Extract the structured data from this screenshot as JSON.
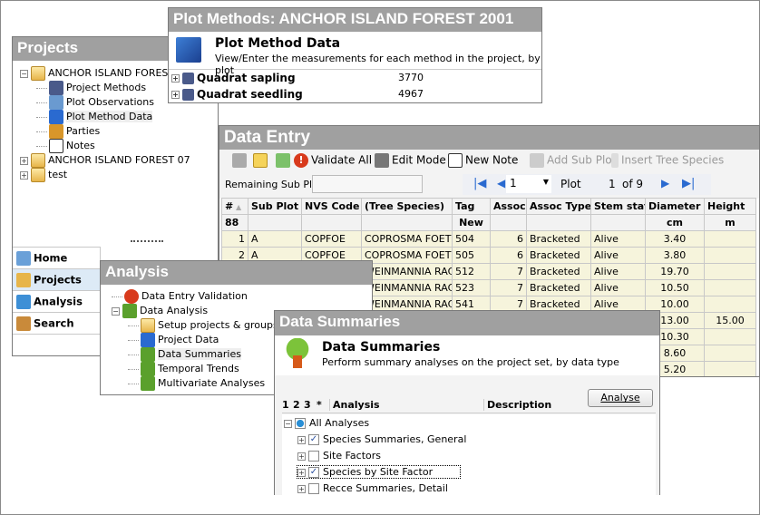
{
  "projects": {
    "title": "Projects",
    "tree": [
      {
        "label": "ANCHOR ISLAND FOREST",
        "exp": "−",
        "icon": "project-folder-icon",
        "level": 0
      },
      {
        "label": "Project Methods",
        "icon": "methods-icon",
        "level": 1
      },
      {
        "label": "Plot Observations",
        "icon": "plot-observations-icon",
        "level": 1
      },
      {
        "label": "Plot Method Data",
        "icon": "plot-method-data-icon",
        "level": 1,
        "selected": true
      },
      {
        "label": "Parties",
        "icon": "parties-icon",
        "level": 1
      },
      {
        "label": "Notes",
        "icon": "notes-icon",
        "level": 1
      },
      {
        "label": "ANCHOR ISLAND FOREST 07",
        "exp": "+",
        "icon": "project-folder-icon",
        "level": 0
      },
      {
        "label": "test",
        "exp": "+",
        "icon": "project-folder-icon",
        "level": 0
      }
    ],
    "nav": [
      {
        "label": "Home",
        "icon": "home-icon"
      },
      {
        "label": "Projects",
        "icon": "projects-icon",
        "selected": true
      },
      {
        "label": "Analysis",
        "icon": "analysis-icon"
      },
      {
        "label": "Search",
        "icon": "search-icon"
      }
    ]
  },
  "plot_methods": {
    "title": "Plot Methods: ANCHOR ISLAND FOREST 2001",
    "heading": "Plot Method Data",
    "subheading": "View/Enter the measurements for each method in the project, by plot",
    "rows": [
      {
        "name": "Quadrat sapling",
        "count": "3770"
      },
      {
        "name": "Quadrat seedling",
        "count": "4967"
      }
    ]
  },
  "data_entry": {
    "title": "Data Entry",
    "toolbar": {
      "validate_all": "Validate All",
      "edit_mode": "Edit Mode",
      "new_note": "New Note",
      "add_sub_plot": "Add Sub Plot",
      "insert_tree_species": "Insert Tree Species"
    },
    "remaining_label": "Remaining Sub Plots",
    "remaining_value": "",
    "pager": {
      "current": "1",
      "label": "Plot",
      "position": "1",
      "of": "of 9"
    },
    "columns": [
      "#",
      "Sub Plot",
      "NVS Code",
      "(Tree Species)",
      "Tag",
      "Assoc",
      "Assoc Type",
      "Stem stat",
      "Diameter",
      "Height"
    ],
    "units": [
      "88",
      "",
      "",
      "",
      "New",
      "",
      "",
      "",
      "cm",
      "m"
    ],
    "rows": [
      [
        "1",
        "A",
        "COPFOE",
        "COPROSMA FOETID",
        "504",
        "6",
        "Bracketed",
        "Alive",
        "3.40",
        ""
      ],
      [
        "2",
        "A",
        "COPFOE",
        "COPROSMA FOETID",
        "505",
        "6",
        "Bracketed",
        "Alive",
        "3.80",
        ""
      ],
      [
        "",
        "",
        "",
        "WEINMANNIA RAC",
        "512",
        "7",
        "Bracketed",
        "Alive",
        "19.70",
        ""
      ],
      [
        "",
        "",
        "",
        "WEINMANNIA RAC",
        "523",
        "7",
        "Bracketed",
        "Alive",
        "10.50",
        ""
      ],
      [
        "",
        "",
        "",
        "WEINMANNIA RAC",
        "541",
        "7",
        "Bracketed",
        "Alive",
        "10.00",
        ""
      ],
      [
        "",
        "",
        "",
        "",
        "",
        "",
        "",
        "",
        "13.00",
        "15.00"
      ],
      [
        "",
        "",
        "",
        "",
        "",
        "",
        "",
        "",
        "10.30",
        ""
      ],
      [
        "",
        "",
        "",
        "",
        "",
        "",
        "",
        "",
        "8.60",
        ""
      ],
      [
        "",
        "",
        "",
        "",
        "",
        "",
        "",
        "",
        "5.20",
        ""
      ]
    ]
  },
  "analysis": {
    "title": "Analysis",
    "tree": [
      {
        "label": "Data Entry Validation",
        "icon": "validation-icon",
        "level": 0
      },
      {
        "label": "Data Analysis",
        "icon": "tree-icon",
        "level": 0,
        "exp": "−"
      },
      {
        "label": "Setup projects & groups",
        "icon": "folder-icon",
        "level": 1
      },
      {
        "label": "Project Data",
        "icon": "project-data-icon",
        "level": 1
      },
      {
        "label": "Data Summaries",
        "icon": "tree-icon",
        "level": 1,
        "selected": true
      },
      {
        "label": "Temporal Trends",
        "icon": "tree-icon",
        "level": 1
      },
      {
        "label": "Multivariate Analyses",
        "icon": "tree-icon",
        "level": 1
      }
    ]
  },
  "data_summaries": {
    "title": "Data Summaries",
    "heading": "Data Summaries",
    "subheading": "Perform summary analyses on the project set, by data type",
    "analyse_button": "Analyse",
    "columns": [
      "1",
      "2",
      "3",
      "*",
      "Analysis",
      "Description"
    ],
    "root": "All Analyses",
    "items": [
      {
        "label": "Species Summaries, General",
        "checked": true
      },
      {
        "label": "Site Factors",
        "checked": false
      },
      {
        "label": "Species by Site Factor",
        "checked": true,
        "focused": true
      },
      {
        "label": "Recce Summaries, Detail",
        "checked": false
      }
    ]
  },
  "colors": {
    "title_bar": "#a0a0a0",
    "row_bg": "#f6f4dc",
    "selected_nav": "#ddeaf6",
    "accent": "#2a6ad0"
  }
}
